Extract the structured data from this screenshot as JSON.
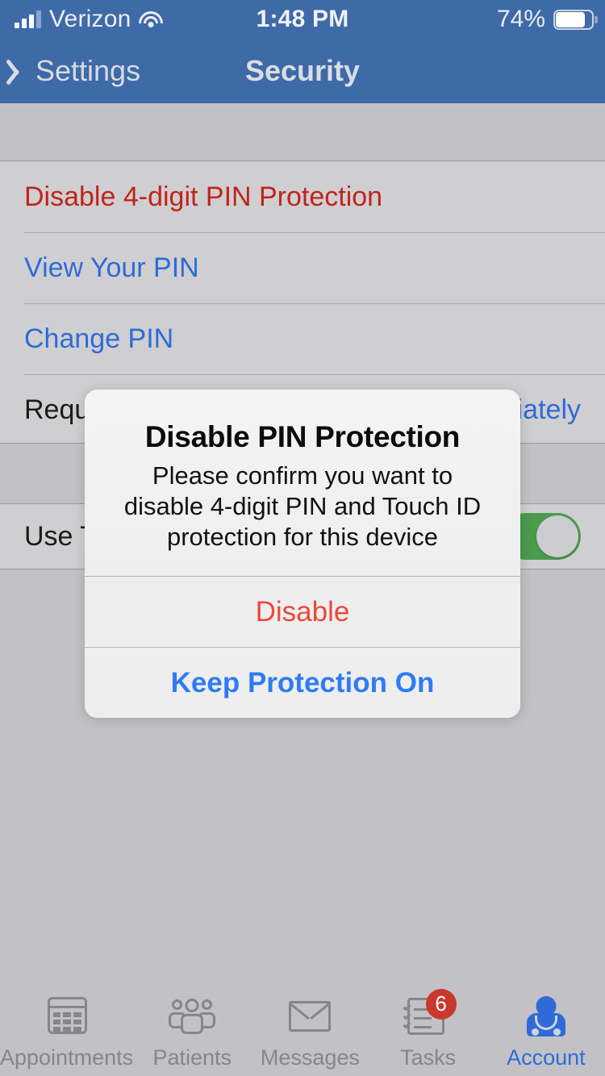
{
  "status_bar": {
    "carrier": "Verizon",
    "time": "1:48 PM",
    "battery_percent": "74%",
    "signal_icon": "signal-bars-icon",
    "wifi_icon": "wifi-icon",
    "battery_icon": "battery-icon"
  },
  "nav_bar": {
    "back_label": "Settings",
    "title": "Security",
    "back_icon": "chevron-left-icon",
    "background_color": "#3e6aa8"
  },
  "settings_list": {
    "group_one": [
      {
        "label": "Disable 4-digit PIN Protection",
        "style": "destructive"
      },
      {
        "label": "View Your PIN",
        "style": "action"
      },
      {
        "label": "Change PIN",
        "style": "action"
      },
      {
        "label": "Require PIN",
        "value": "Immediately",
        "style": "plain"
      }
    ],
    "group_two": [
      {
        "label": "Use Touch ID",
        "style": "plain",
        "toggle": "on"
      }
    ]
  },
  "alert": {
    "title": "Disable PIN Protection",
    "message": "Please confirm you want to disable 4-digit PIN and Touch ID protection for this device",
    "destructive_button": "Disable",
    "default_button": "Keep Protection On",
    "destructive_color": "#e8493c",
    "default_color": "#2f7bf5"
  },
  "tab_bar": {
    "items": [
      {
        "label": "Appointments",
        "icon": "calendar-icon",
        "active": false
      },
      {
        "label": "Patients",
        "icon": "people-icon",
        "active": false
      },
      {
        "label": "Messages",
        "icon": "envelope-icon",
        "active": false
      },
      {
        "label": "Tasks",
        "icon": "checklist-icon",
        "active": false,
        "badge": "6"
      },
      {
        "label": "Account",
        "icon": "doctor-icon",
        "active": true
      }
    ],
    "active_color": "#2f6bd8",
    "inactive_color": "#86868a",
    "badge_color": "#c8382c"
  }
}
